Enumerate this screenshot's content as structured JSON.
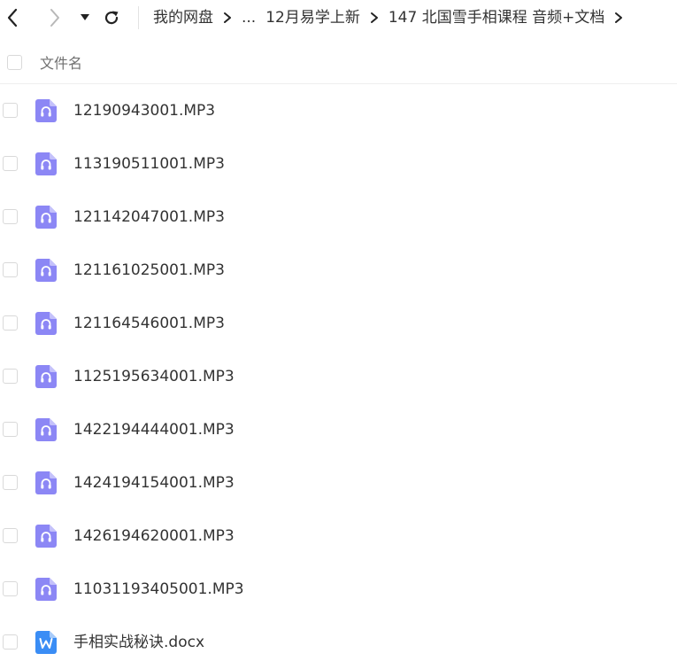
{
  "toolbar": {
    "back_icon": "chevron-left-icon",
    "forward_icon": "chevron-right-icon",
    "history_dropdown_icon": "caret-down-icon",
    "refresh_icon": "refresh-icon"
  },
  "breadcrumb": {
    "root": "我的网盘",
    "ellipsis": "...",
    "items": [
      "12月易学上新",
      "147 北国雪手相课程 音频+文档"
    ],
    "separator_icon": "chevron-right-icon"
  },
  "list_header": {
    "name_label": "文件名"
  },
  "files": [
    {
      "name": "12190943001.MP3",
      "type": "audio"
    },
    {
      "name": "113190511001.MP3",
      "type": "audio"
    },
    {
      "name": "121142047001.MP3",
      "type": "audio"
    },
    {
      "name": "121161025001.MP3",
      "type": "audio"
    },
    {
      "name": "121164546001.MP3",
      "type": "audio"
    },
    {
      "name": "1125195634001.MP3",
      "type": "audio"
    },
    {
      "name": "1422194444001.MP3",
      "type": "audio"
    },
    {
      "name": "1424194154001.MP3",
      "type": "audio"
    },
    {
      "name": "1426194620001.MP3",
      "type": "audio"
    },
    {
      "name": "11031193405001.MP3",
      "type": "audio"
    },
    {
      "name": "手相实战秘诀.docx",
      "type": "word"
    }
  ],
  "colors": {
    "audio_icon": "#8c87f5",
    "word_icon": "#3a8df5",
    "icon_fold": "#c4c1fb"
  }
}
